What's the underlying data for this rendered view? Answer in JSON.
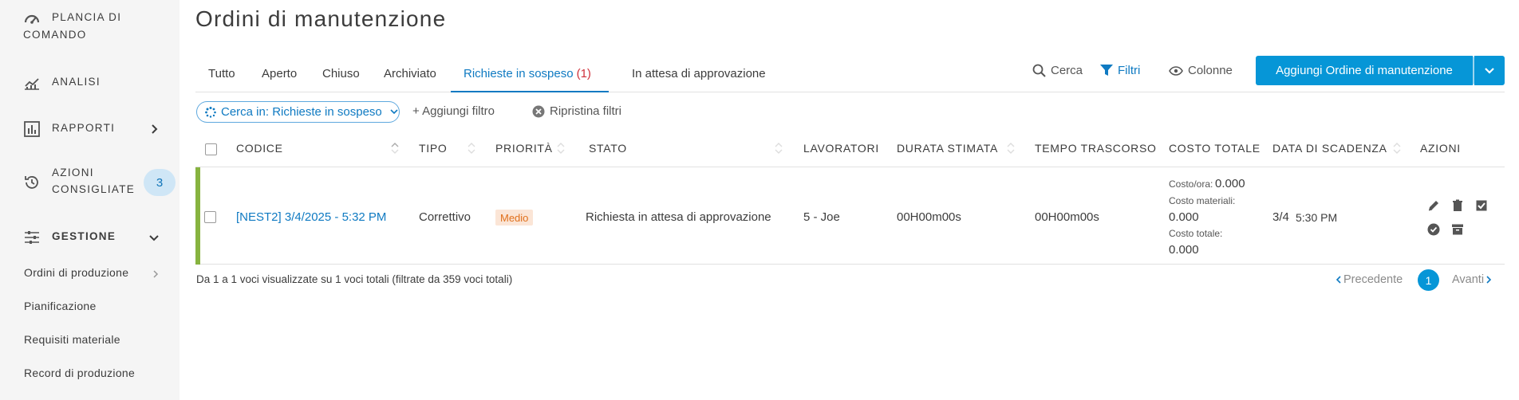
{
  "sidebar": {
    "dashboard": {
      "label_line1": "PLANCIA DI",
      "label_line2": "COMANDO",
      "icon": "gauge-icon"
    },
    "analysis": {
      "label": "ANALISI",
      "icon": "chart-icon"
    },
    "reports": {
      "label": "RAPPORTI",
      "icon": "bar-report-icon"
    },
    "suggested": {
      "label_line1": "AZIONI",
      "label_line2": "CONSIGLIATE",
      "badge": "3",
      "icon": "history-icon"
    },
    "management": {
      "label": "GESTIONE",
      "icon": "sliders-icon"
    },
    "sub_items": [
      {
        "label": "Ordini di produzione"
      },
      {
        "label": "Pianificazione"
      },
      {
        "label": "Requisiti materiale"
      },
      {
        "label": "Record di produzione"
      }
    ]
  },
  "page": {
    "title": "Ordini di manutenzione"
  },
  "tabs": [
    {
      "label": "Tutto"
    },
    {
      "label": "Aperto"
    },
    {
      "label": "Chiuso"
    },
    {
      "label": "Archiviato"
    },
    {
      "label": "Richieste in sospeso",
      "count": "(1)",
      "active": true
    },
    {
      "label": "In attesa di approvazione"
    }
  ],
  "toolbar": {
    "search": "Cerca",
    "filters": "Filtri",
    "columns": "Colonne",
    "add_button": "Aggiungi Ordine di manutenzione"
  },
  "filters": {
    "chip": "Cerca in: Richieste in sospeso",
    "add_filter": "+ Aggiungi filtro",
    "reset": "Ripristina filtri"
  },
  "table": {
    "headers": {
      "code": "CODICE",
      "type": "TIPO",
      "priority": "PRIORITÀ",
      "status": "STATO",
      "workers": "LAVORATORI",
      "est_duration": "DURATA STIMATA",
      "elapsed": "TEMPO TRASCORSO",
      "total_cost": "COSTO TOTALE",
      "due_date": "DATA DI SCADENZA",
      "actions": "AZIONI"
    },
    "rows": [
      {
        "code": "[NEST2] 3/4/2025 - 5:32 PM",
        "type": "Correttivo",
        "priority": "Medio",
        "status": "Richiesta in attesa di approvazione",
        "workers": "5 - Joe",
        "est_duration": "00H00m00s",
        "elapsed": "00H00m00s",
        "cost_hour_label": "Costo/ora:",
        "cost_hour": "0.000",
        "cost_material_label": "Costo materiali:",
        "cost_material": "0.000",
        "cost_total_label": "Costo totale:",
        "cost_total": "0.000",
        "due_date": "3/4",
        "due_time": "5:30 PM",
        "accent_color": "#87b340"
      }
    ]
  },
  "footer": {
    "summary": "Da 1 a 1 voci visualizzate su 1 voci totali (filtrate da 359 voci totali)",
    "prev": "Precedente",
    "page": "1",
    "next": "Avanti"
  },
  "colors": {
    "accent": "#0696d7",
    "link": "#0f7ac2",
    "priority_bg": "#fbe5d6",
    "priority_fg": "#e0701c"
  }
}
